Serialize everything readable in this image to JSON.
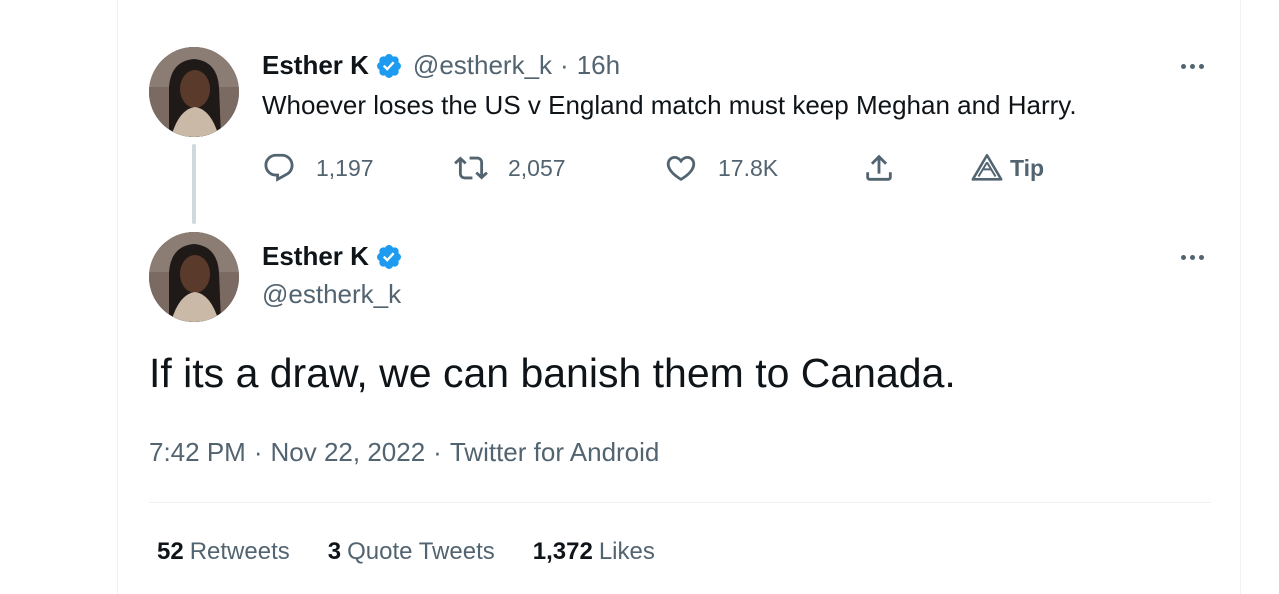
{
  "reply_tweet": {
    "author_name": "Esther K",
    "handle": "@estherk_k",
    "time_sep": "·",
    "time": "16h",
    "text": "Whoever loses the US v England match must keep Meghan and Harry.",
    "actions": {
      "replies": "1,197",
      "retweets": "2,057",
      "likes": "17.8K",
      "tip_label": "Tip"
    }
  },
  "main_tweet": {
    "author_name": "Esther K",
    "handle": "@estherk_k",
    "text": "If its a draw, we can banish them to Canada.",
    "time": "7:42 PM",
    "sep1": "·",
    "date": "Nov 22, 2022",
    "sep2": "·",
    "source": "Twitter for Android",
    "stats": {
      "retweets_count": "52",
      "retweets_label": "Retweets",
      "quotes_count": "3",
      "quotes_label": "Quote Tweets",
      "likes_count": "1,372",
      "likes_label": "Likes"
    }
  },
  "icons": [
    "avatar",
    "verified-badge-icon",
    "more-icon",
    "reply-icon",
    "retweet-icon",
    "like-icon",
    "share-icon",
    "tip-icon"
  ],
  "colors": {
    "verified": "#1d9bf0",
    "secondary_text": "#536471",
    "primary_text": "#0f1419",
    "thread_line": "#cfd9de"
  }
}
